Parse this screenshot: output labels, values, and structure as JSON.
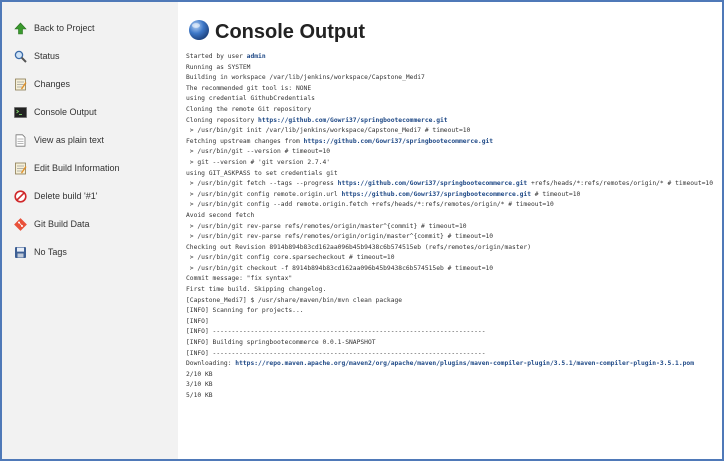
{
  "sidebar": {
    "items": [
      {
        "label": "Back to Project",
        "icon": "up-arrow-icon"
      },
      {
        "label": "Status",
        "icon": "magnifier-icon"
      },
      {
        "label": "Changes",
        "icon": "notepad-icon"
      },
      {
        "label": "Console Output",
        "icon": "terminal-icon"
      },
      {
        "label": "View as plain text",
        "icon": "document-icon"
      },
      {
        "label": "Edit Build Information",
        "icon": "notepad-icon"
      },
      {
        "label": "Delete build '#1'",
        "icon": "no-entry-icon"
      },
      {
        "label": "Git Build Data",
        "icon": "git-icon"
      },
      {
        "label": "No Tags",
        "icon": "save-icon"
      }
    ]
  },
  "main": {
    "title": "Console Output",
    "console_lines": [
      {
        "text": "Started by user ",
        "link": "admin",
        "after": ""
      },
      {
        "text": "Running as SYSTEM"
      },
      {
        "text": "Building in workspace /var/lib/jenkins/workspace/Capstone_Medi7"
      },
      {
        "text": "The recommended git tool is: NONE"
      },
      {
        "text": "using credential GithubCredentials"
      },
      {
        "text": "Cloning the remote Git repository"
      },
      {
        "text": "Cloning repository ",
        "link": "https://github.com/Gowri37/springbootecommerce.git",
        "after": ""
      },
      {
        "text": " > /usr/bin/git init /var/lib/jenkins/workspace/Capstone_Medi7 # timeout=10"
      },
      {
        "text": "Fetching upstream changes from ",
        "link": "https://github.com/Gowri37/springbootecommerce.git",
        "after": ""
      },
      {
        "text": " > /usr/bin/git --version # timeout=10"
      },
      {
        "text": " > git --version # 'git version 2.7.4'"
      },
      {
        "text": "using GIT_ASKPASS to set credentials git"
      },
      {
        "text": " > /usr/bin/git fetch --tags --progress ",
        "link": "https://github.com/Gowri37/springbootecommerce.git",
        "after": " +refs/heads/*:refs/remotes/origin/* # timeout=10"
      },
      {
        "text": " > /usr/bin/git config remote.origin.url ",
        "link": "https://github.com/Gowri37/springbootecommerce.git",
        "after": " # timeout=10"
      },
      {
        "text": " > /usr/bin/git config --add remote.origin.fetch +refs/heads/*:refs/remotes/origin/* # timeout=10"
      },
      {
        "text": "Avoid second fetch"
      },
      {
        "text": " > /usr/bin/git rev-parse refs/remotes/origin/master^{commit} # timeout=10"
      },
      {
        "text": " > /usr/bin/git rev-parse refs/remotes/origin/origin/master^{commit} # timeout=10"
      },
      {
        "text": "Checking out Revision 8914b894b83cd162aa096b45b9438c6b574515eb (refs/remotes/origin/master)"
      },
      {
        "text": " > /usr/bin/git config core.sparsecheckout # timeout=10"
      },
      {
        "text": " > /usr/bin/git checkout -f 8914b894b83cd162aa096b45b9438c6b574515eb # timeout=10"
      },
      {
        "text": "Commit message: \"fix syntax\""
      },
      {
        "text": "First time build. Skipping changelog."
      },
      {
        "text": "[Capstone_Medi7] $ /usr/share/maven/bin/mvn clean package"
      },
      {
        "text": "[INFO] Scanning for projects..."
      },
      {
        "text": "[INFO]"
      },
      {
        "text": "[INFO] ------------------------------------------------------------------------"
      },
      {
        "text": "[INFO] Building springbootecommerce 0.0.1-SNAPSHOT"
      },
      {
        "text": "[INFO] ------------------------------------------------------------------------"
      },
      {
        "text": "Downloading: ",
        "link": "https://repo.maven.apache.org/maven2/org/apache/maven/plugins/maven-compiler-plugin/3.5.1/maven-compiler-plugin-3.5.1.pom",
        "after": ""
      },
      {
        "text": "2/10 KB"
      },
      {
        "text": "3/10 KB"
      },
      {
        "text": "5/10 KB"
      }
    ]
  }
}
